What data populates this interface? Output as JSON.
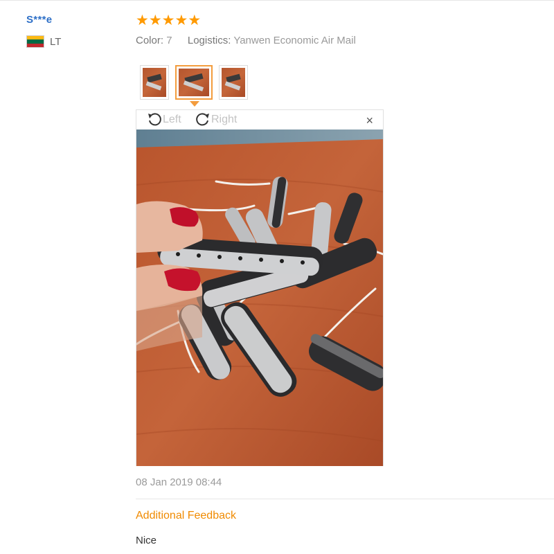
{
  "user": {
    "name": "S***e",
    "country_code": "LT",
    "flag_colors": [
      "#fdb913",
      "#006a44",
      "#c1272d"
    ]
  },
  "review": {
    "rating": 5,
    "star_color": "#ff9a00",
    "color_label": "Color:",
    "color_value": "7",
    "logistics_label": "Logistics:",
    "logistics_value": "Yanwen Economic Air Mail",
    "thumbnail_count": 3,
    "active_thumbnail": 2,
    "date": "08 Jan 2019 08:44",
    "feedback_title": "Additional Feedback",
    "feedback_text": "Nice"
  },
  "viewer": {
    "rotate_left_label": "Left",
    "rotate_right_label": "Right",
    "close_icon": "×"
  }
}
